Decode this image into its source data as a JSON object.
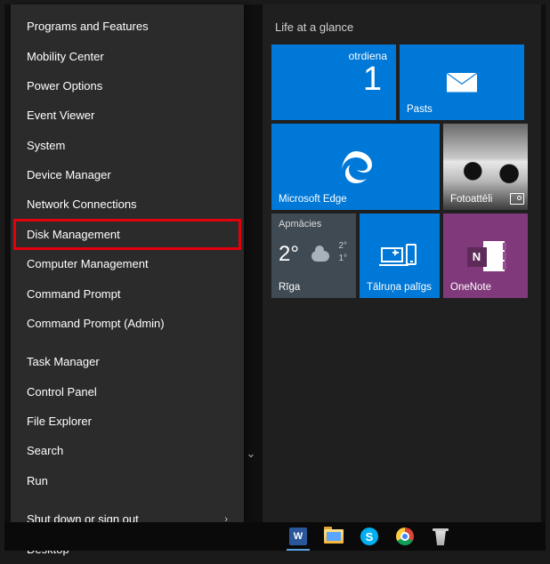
{
  "winx": {
    "items": [
      {
        "label": "Programs and Features",
        "highlight": false
      },
      {
        "label": "Mobility Center",
        "highlight": false
      },
      {
        "label": "Power Options",
        "highlight": false
      },
      {
        "label": "Event Viewer",
        "highlight": false
      },
      {
        "label": "System",
        "highlight": false
      },
      {
        "label": "Device Manager",
        "highlight": false
      },
      {
        "label": "Network Connections",
        "highlight": false
      },
      {
        "label": "Disk Management",
        "highlight": true
      },
      {
        "label": "Computer Management",
        "highlight": false
      },
      {
        "label": "Command Prompt",
        "highlight": false
      },
      {
        "label": "Command Prompt (Admin)",
        "highlight": false
      }
    ],
    "items2": [
      {
        "label": "Task Manager"
      },
      {
        "label": "Control Panel"
      },
      {
        "label": "File Explorer"
      },
      {
        "label": "Search"
      },
      {
        "label": "Run"
      }
    ],
    "items3": [
      {
        "label": "Shut down or sign out",
        "submenu": true
      },
      {
        "label": "Desktop",
        "submenu": false
      }
    ]
  },
  "start": {
    "section_title": "Life at a glance",
    "calendar": {
      "day": "otrdiena",
      "date": "1"
    },
    "mail": {
      "label": "Pasts"
    },
    "edge": {
      "label": "Microsoft Edge"
    },
    "photos": {
      "label": "Fotoattēli"
    },
    "weather": {
      "condition": "Apmācies",
      "temp": "2°",
      "hi": "2°",
      "lo": "1°",
      "city": "Rīga"
    },
    "phone": {
      "label": "Tālruņa palīgs"
    },
    "onenote": {
      "label": "OneNote",
      "badge": "N"
    }
  },
  "taskbar": {
    "word": "W",
    "skype": "S"
  }
}
